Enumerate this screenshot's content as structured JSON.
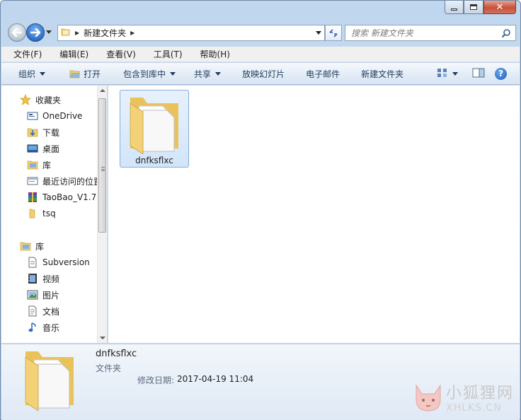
{
  "window": {
    "close_glyph": "✕"
  },
  "address": {
    "crumb": "新建文件夹",
    "separator": "▶"
  },
  "search": {
    "placeholder": "搜索 新建文件夹"
  },
  "menu": {
    "items": [
      "文件(F)",
      "编辑(E)",
      "查看(V)",
      "工具(T)",
      "帮助(H)"
    ]
  },
  "toolbar": {
    "organize": "组织",
    "open": "打开",
    "include_in_library": "包含到库中",
    "share": "共享",
    "slideshow": "放映幻灯片",
    "email": "电子邮件",
    "new_folder": "新建文件夹",
    "help_glyph": "?"
  },
  "nav_pane": {
    "favorites": {
      "label": "收藏夹",
      "items": [
        "OneDrive",
        "下载",
        "桌面",
        "库",
        "最近访问的位置",
        "TaoBao_V1.7",
        "tsq"
      ]
    },
    "libraries": {
      "label": "库",
      "items": [
        "Subversion",
        "视频",
        "图片",
        "文档",
        "音乐"
      ]
    }
  },
  "content": {
    "items": [
      {
        "name": "dnfksflxc",
        "icon": "folder-icon",
        "selected": true
      }
    ]
  },
  "details": {
    "name": "dnfksflxc",
    "type": "文件夹",
    "date_label": "修改日期:",
    "date_value": "2017-04-19 11:04"
  },
  "watermark": {
    "text_cn": "小狐狸网",
    "text_en": "XHLKS.CN"
  },
  "colors": {
    "accent": "#2d6fc6",
    "selection": "#cde3f8",
    "folder": "#f1cf6e"
  }
}
